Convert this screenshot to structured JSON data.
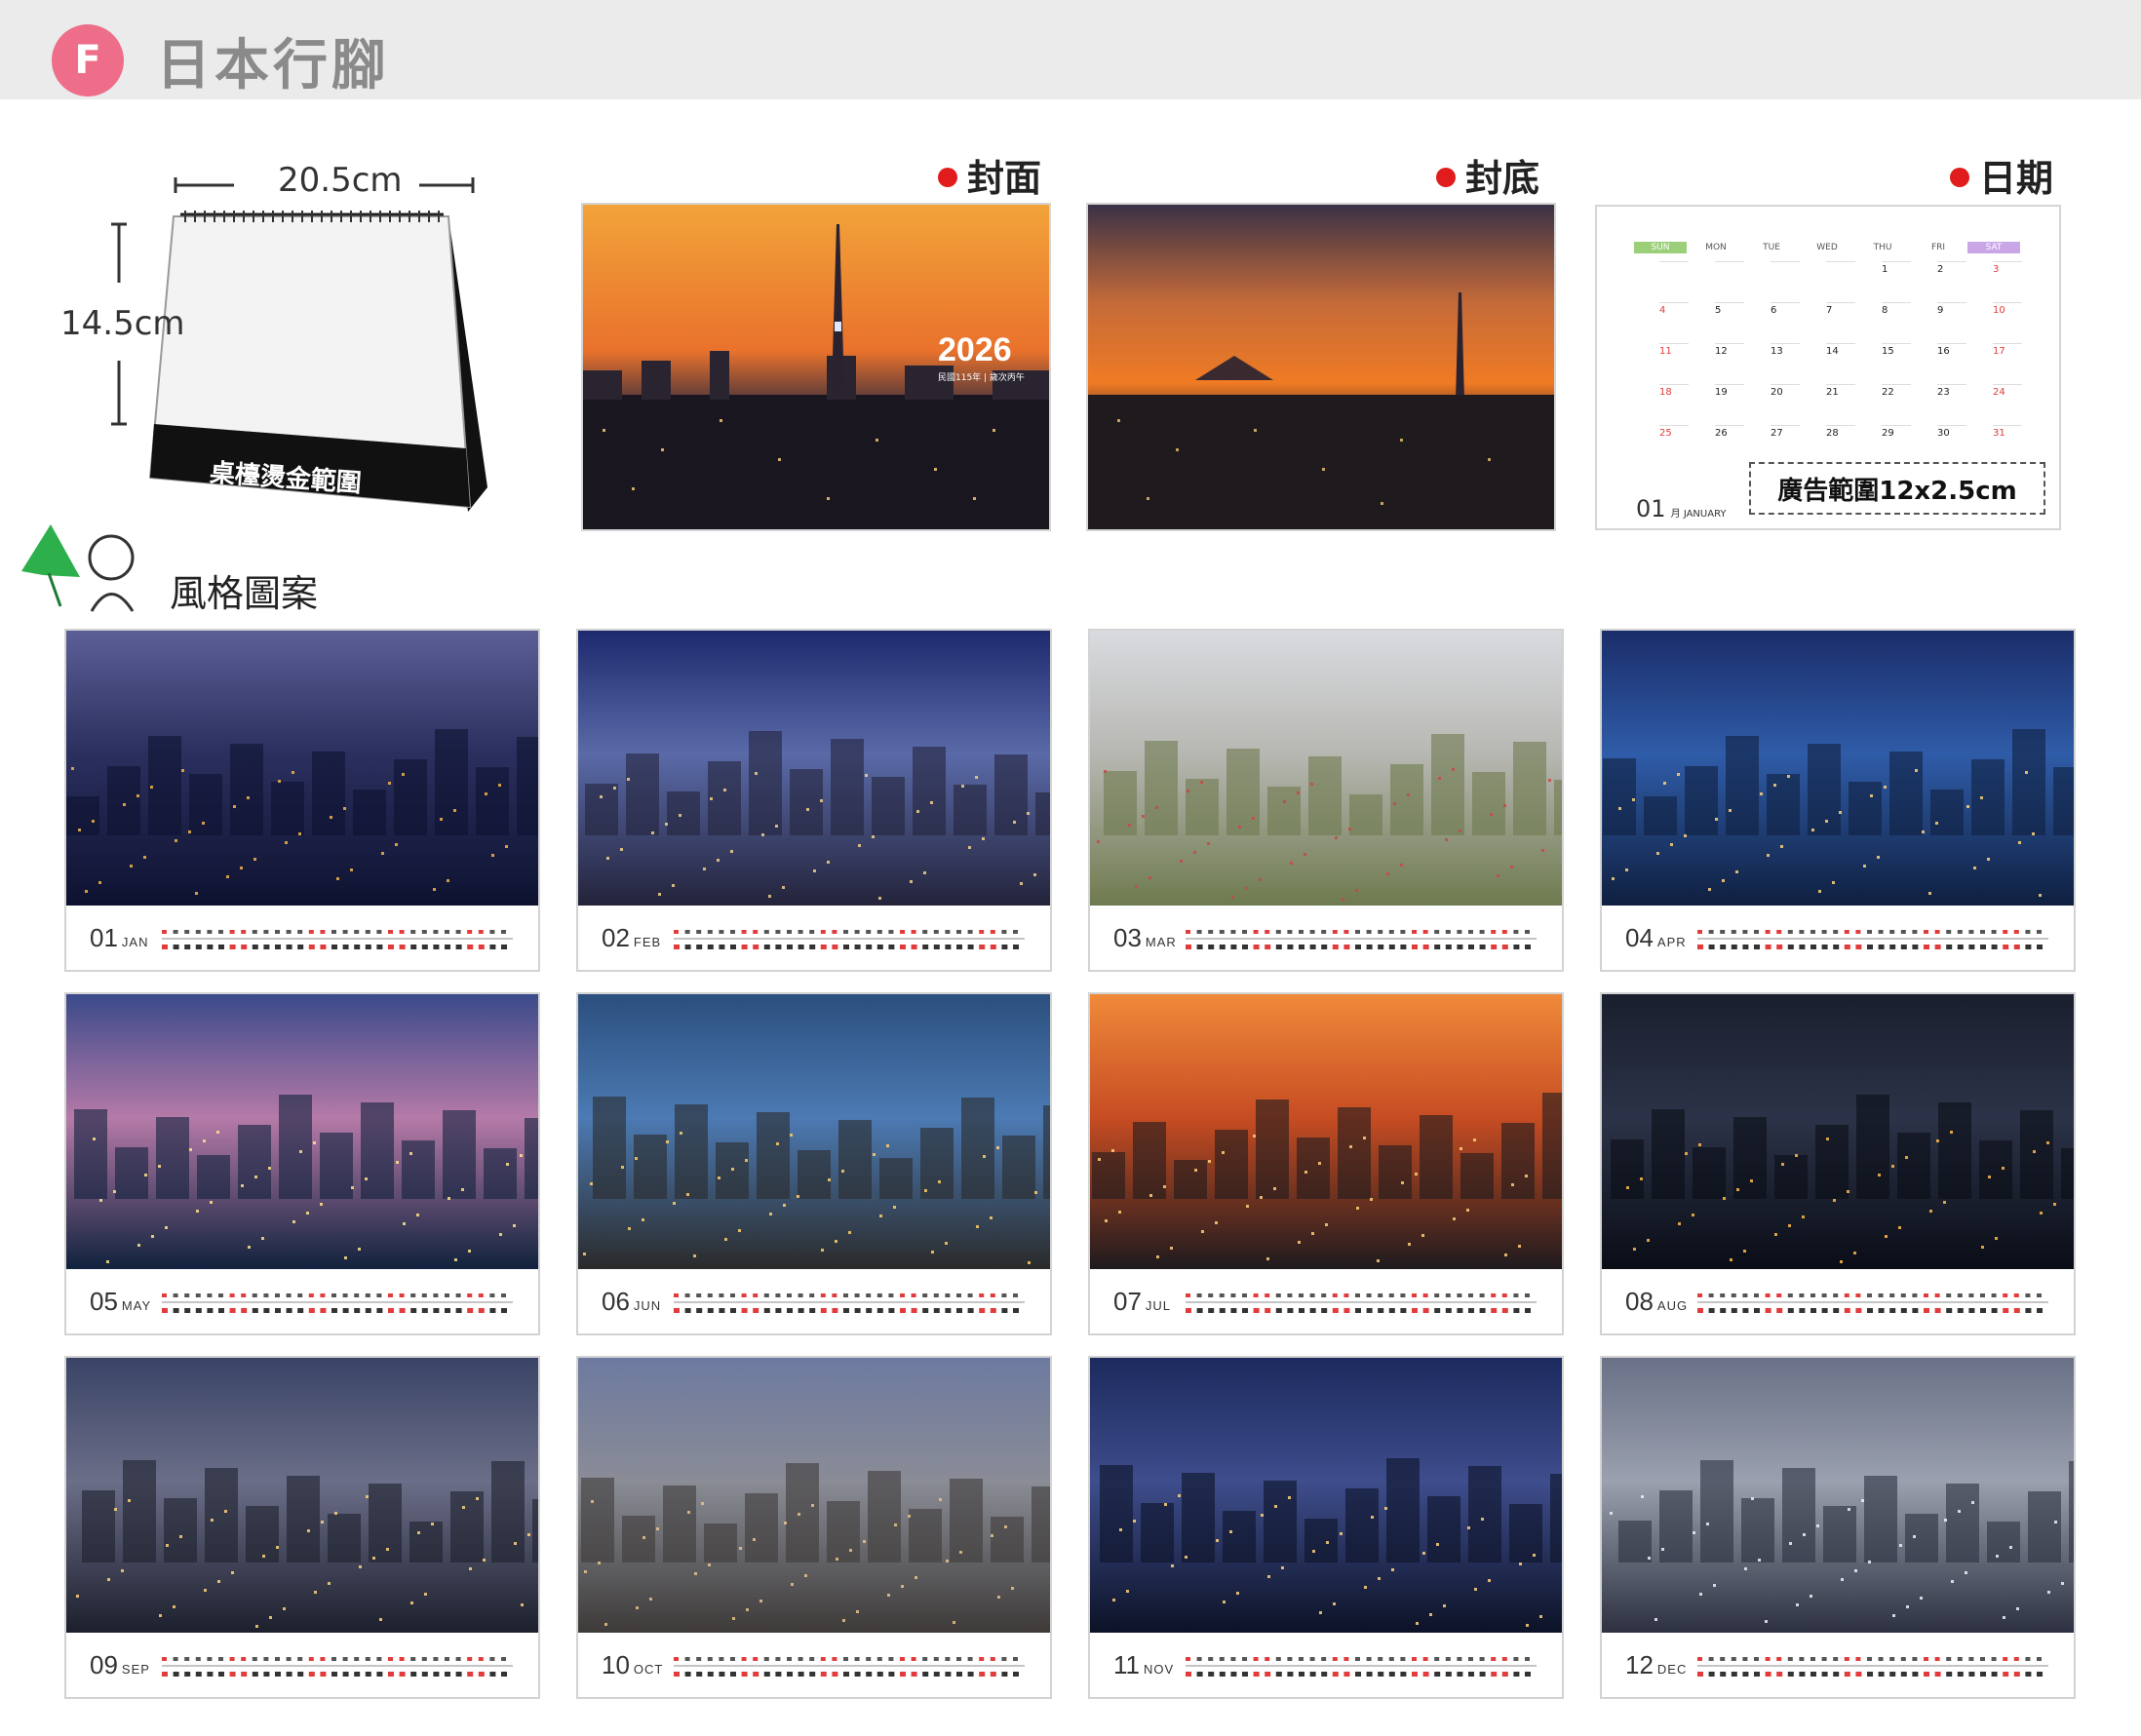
{
  "header": {
    "badge": "F",
    "title": "日本行腳"
  },
  "dimensions": {
    "width": "20.5cm",
    "height": "14.5cm",
    "stand_label": "桌檯燙金範圍"
  },
  "sections": {
    "cover": "封面",
    "back": "封底",
    "date": "日期",
    "style": "風格圖案"
  },
  "cover": {
    "year": "2026",
    "sub": "民國115年 | 歲次丙午"
  },
  "date_page": {
    "weekdays": [
      "SUN",
      "MON",
      "TUE",
      "WED",
      "THU",
      "FRI",
      "SAT"
    ],
    "rows": [
      [
        "",
        "",
        "",
        "",
        "1",
        "2",
        "3"
      ],
      [
        "4",
        "5",
        "6",
        "7",
        "8",
        "9",
        "10"
      ],
      [
        "11",
        "12",
        "13",
        "14",
        "15",
        "16",
        "17"
      ],
      [
        "18",
        "19",
        "20",
        "21",
        "22",
        "23",
        "24"
      ],
      [
        "25",
        "26",
        "27",
        "28",
        "29",
        "30",
        "31"
      ]
    ],
    "month_num": "01",
    "month_label": "月 JANUARY",
    "ad_text": "廣告範圍12x2.5cm"
  },
  "months": [
    {
      "num": "01",
      "name": "JAN"
    },
    {
      "num": "02",
      "name": "FEB"
    },
    {
      "num": "03",
      "name": "MAR"
    },
    {
      "num": "04",
      "name": "APR"
    },
    {
      "num": "05",
      "name": "MAY"
    },
    {
      "num": "06",
      "name": "JUN"
    },
    {
      "num": "07",
      "name": "JUL"
    },
    {
      "num": "08",
      "name": "AUG"
    },
    {
      "num": "09",
      "name": "SEP"
    },
    {
      "num": "10",
      "name": "OCT"
    },
    {
      "num": "11",
      "name": "NOV"
    },
    {
      "num": "12",
      "name": "DEC"
    }
  ],
  "colors": {
    "badge": "#ee6d89",
    "accent_red": "#e01c1c",
    "weekend_red": "#e23b3b",
    "sun_green": "#9ccf7a",
    "sat_purple": "#c9a6e6"
  }
}
